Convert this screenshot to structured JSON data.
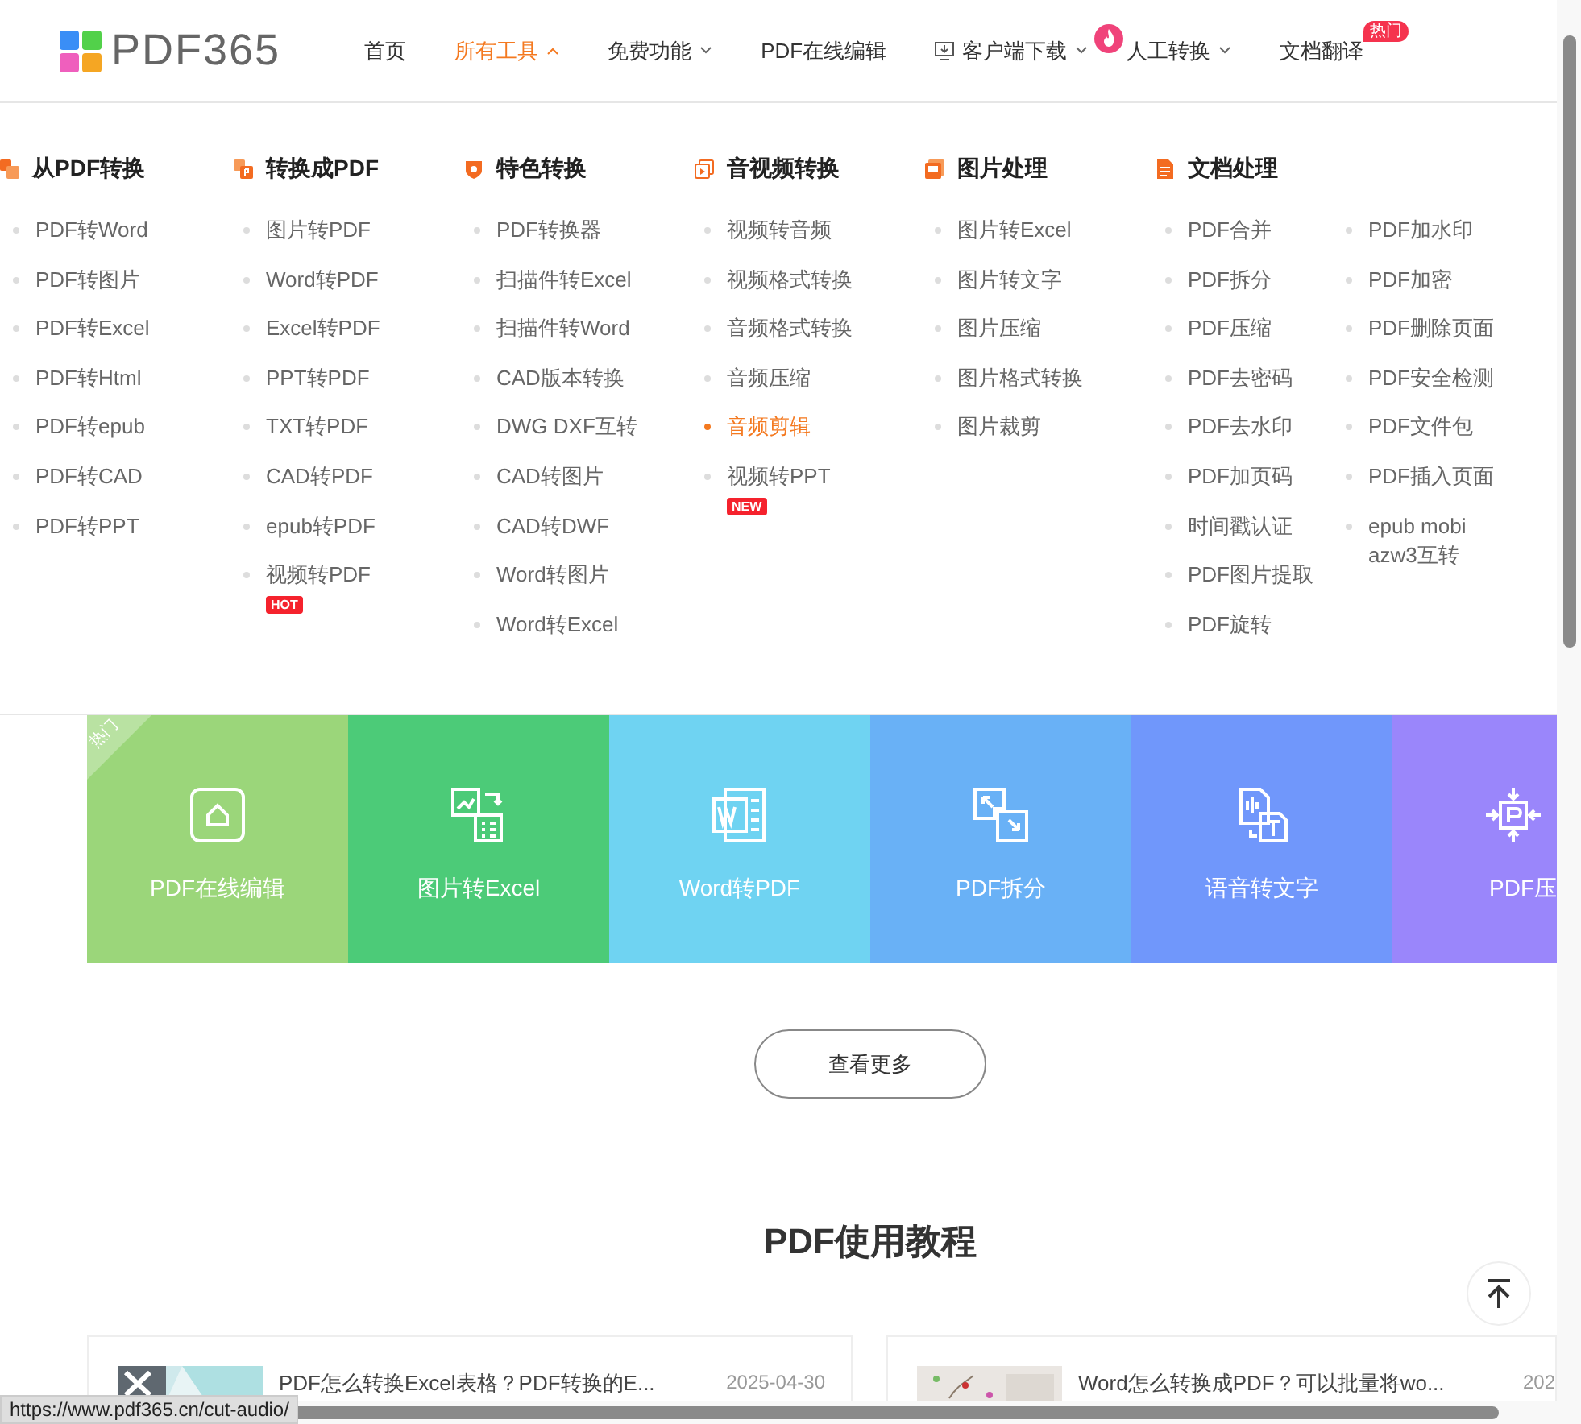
{
  "header": {
    "logo": "PDF365",
    "nav": [
      {
        "label": "首页",
        "selected": false,
        "dropdown": false
      },
      {
        "label": "所有工具",
        "selected": true,
        "dropdown": true,
        "expanded": true
      },
      {
        "label": "免费功能",
        "selected": false,
        "dropdown": true,
        "expanded": false
      },
      {
        "label": "PDF在线编辑",
        "selected": false,
        "dropdown": false
      },
      {
        "label": "客户端下载",
        "selected": false,
        "dropdown": true,
        "expanded": false
      },
      {
        "label": "人工转换",
        "selected": false,
        "dropdown": true,
        "expanded": false
      },
      {
        "label": "文档翻译",
        "selected": false,
        "dropdown": false,
        "badge": "热门"
      }
    ]
  },
  "menu": [
    {
      "title": "从PDF转换",
      "lists": [
        [
          {
            "label": "PDF转Word",
            "selected": false
          },
          {
            "label": "PDF转图片",
            "selected": false
          },
          {
            "label": "PDF转Excel",
            "selected": false
          },
          {
            "label": "PDF转Html",
            "selected": false
          },
          {
            "label": "PDF转epub",
            "selected": false
          },
          {
            "label": "PDF转CAD",
            "selected": false
          },
          {
            "label": "PDF转PPT",
            "selected": false
          }
        ]
      ]
    },
    {
      "title": "转换成PDF",
      "lists": [
        [
          {
            "label": "图片转PDF",
            "selected": false
          },
          {
            "label": "Word转PDF",
            "selected": false
          },
          {
            "label": "Excel转PDF",
            "selected": false
          },
          {
            "label": "PPT转PDF",
            "selected": false
          },
          {
            "label": "TXT转PDF",
            "selected": false
          },
          {
            "label": "CAD转PDF",
            "selected": false
          },
          {
            "label": "epub转PDF",
            "selected": false
          },
          {
            "label": "视频转PDF",
            "selected": false,
            "badge": "HOT"
          }
        ]
      ]
    },
    {
      "title": "特色转换",
      "lists": [
        [
          {
            "label": "PDF转换器",
            "selected": false
          },
          {
            "label": "扫描件转Excel",
            "selected": false
          },
          {
            "label": "扫描件转Word",
            "selected": false
          },
          {
            "label": "CAD版本转换",
            "selected": false
          },
          {
            "label": "DWG DXF互转",
            "selected": false
          },
          {
            "label": "CAD转图片",
            "selected": false
          },
          {
            "label": "CAD转DWF",
            "selected": false
          },
          {
            "label": "Word转图片",
            "selected": false
          },
          {
            "label": "Word转Excel",
            "selected": false
          }
        ]
      ]
    },
    {
      "title": "音视频转换",
      "lists": [
        [
          {
            "label": "视频转音频",
            "selected": false
          },
          {
            "label": "视频格式转换",
            "selected": false
          },
          {
            "label": "音频格式转换",
            "selected": false
          },
          {
            "label": "音频压缩",
            "selected": false
          },
          {
            "label": "音频剪辑",
            "selected": true
          },
          {
            "label": "视频转PPT",
            "selected": false,
            "badge": "NEW"
          }
        ]
      ]
    },
    {
      "title": "图片处理",
      "lists": [
        [
          {
            "label": "图片转Excel",
            "selected": false
          },
          {
            "label": "图片转文字",
            "selected": false
          },
          {
            "label": "图片压缩",
            "selected": false
          },
          {
            "label": "图片格式转换",
            "selected": false
          },
          {
            "label": "图片裁剪",
            "selected": false
          }
        ]
      ]
    },
    {
      "title": "文档处理",
      "lists": [
        [
          {
            "label": "PDF合并",
            "selected": false
          },
          {
            "label": "PDF拆分",
            "selected": false
          },
          {
            "label": "PDF压缩",
            "selected": false
          },
          {
            "label": "PDF去密码",
            "selected": false
          },
          {
            "label": "PDF去水印",
            "selected": false
          },
          {
            "label": "PDF加页码",
            "selected": false
          },
          {
            "label": "时间戳认证",
            "selected": false
          },
          {
            "label": "PDF图片提取",
            "selected": false
          },
          {
            "label": "PDF旋转",
            "selected": false
          }
        ],
        [
          {
            "label": "PDF加水印",
            "selected": false
          },
          {
            "label": "PDF加密",
            "selected": false
          },
          {
            "label": "PDF删除页面",
            "selected": false
          },
          {
            "label": "PDF安全检测",
            "selected": false
          },
          {
            "label": "PDF文件包",
            "selected": false
          },
          {
            "label": "PDF插入页面",
            "selected": false
          },
          {
            "label": "epub mobi azw3互转",
            "selected": false
          }
        ]
      ]
    }
  ],
  "tiles": [
    {
      "label": "PDF在线编辑",
      "color": "#9bd67a",
      "ribbon": "热门"
    },
    {
      "label": "图片转Excel",
      "color": "#4ccb78"
    },
    {
      "label": "Word转PDF",
      "color": "#6fd3f2"
    },
    {
      "label": "PDF拆分",
      "color": "#69b1f6"
    },
    {
      "label": "语音转文字",
      "color": "#7097fb"
    },
    {
      "label": "PDF压",
      "color": "#9a86fb"
    }
  ],
  "more_button": "查看更多",
  "tutorials": {
    "title": "PDF使用教程",
    "cards": [
      {
        "title": "PDF怎么转换Excel表格？PDF转换的E...",
        "date": "2025-04-30"
      },
      {
        "title": "Word怎么转换成PDF？可以批量将wo...",
        "date": "202"
      }
    ]
  },
  "status_url": "https://www.pdf365.cn/cut-audio/"
}
